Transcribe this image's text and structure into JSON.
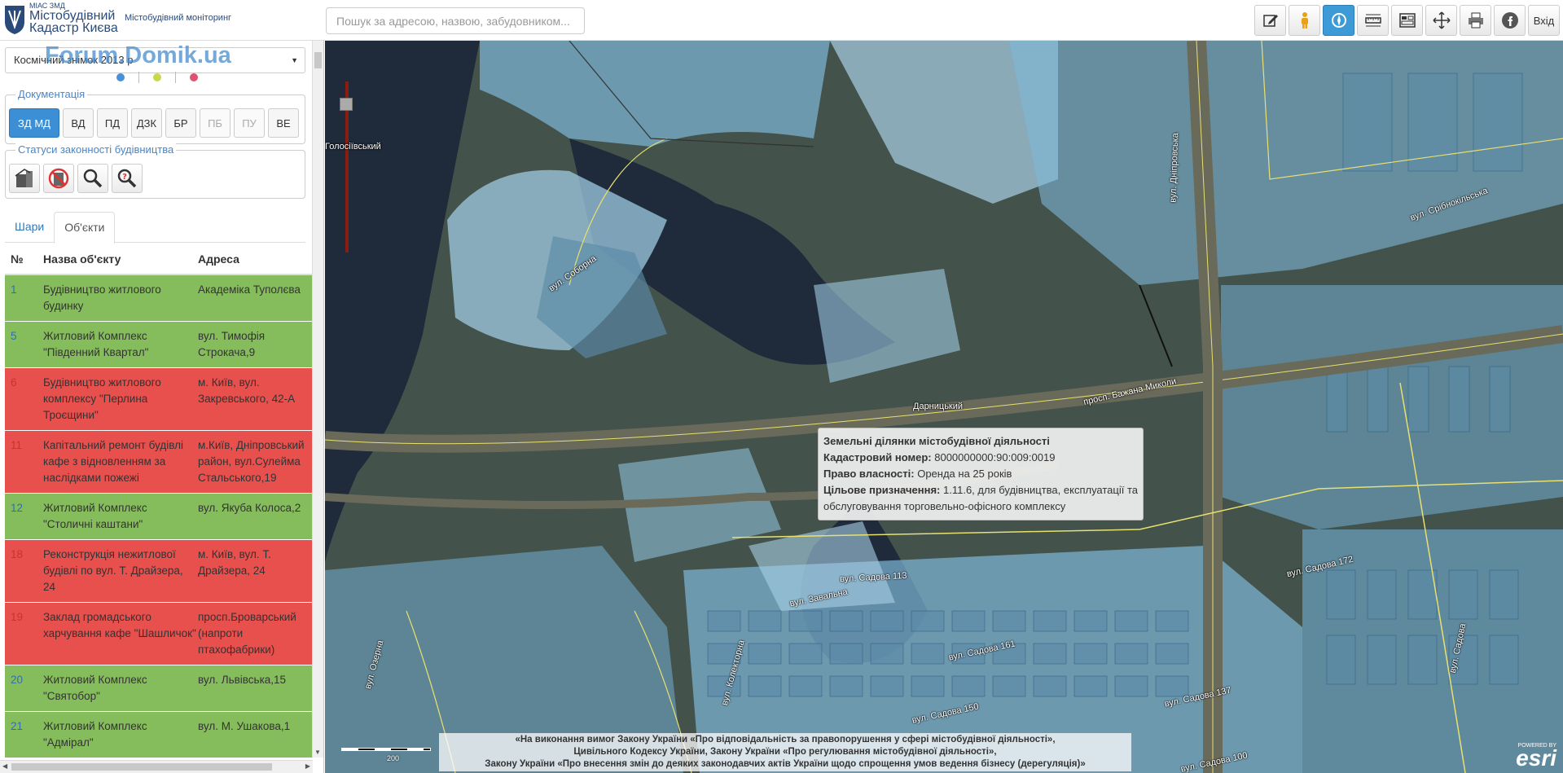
{
  "header": {
    "logo_small": "МІАС ЗМД",
    "logo_line1": "Містобудівний",
    "logo_line2": "Кадастр Києва",
    "monitor_label": "Містобудівний моніторинг",
    "search_placeholder": "Пошук за адресою, назвою, забудовником...",
    "toolbar": [
      {
        "icon": "edit-icon"
      },
      {
        "icon": "street-view-person-icon"
      },
      {
        "icon": "compass-icon",
        "active": true
      },
      {
        "icon": "measure-ruler-icon"
      },
      {
        "icon": "layers-compare-icon"
      },
      {
        "icon": "crosshair-move-icon"
      },
      {
        "icon": "print-icon"
      },
      {
        "icon": "facebook-icon"
      }
    ],
    "login_label": "Вхід"
  },
  "sidebar": {
    "basemap_value": "Космічний знімок 2013 р",
    "watermark": "Forum.Domik.ua",
    "dot_colors": [
      "#4a90d9",
      "#c8d84a",
      "#e05070"
    ],
    "documentation": {
      "legend": "Документація",
      "buttons": [
        "ЗД МД",
        "ВД",
        "ПД",
        "ДЗК",
        "БР",
        "ПБ",
        "ПУ",
        "ВЕ"
      ]
    },
    "statuses": {
      "legend": "Статуси законності будівництва",
      "buttons": [
        "legal-building-icon",
        "illegal-building-icon",
        "inspection-magnifier-icon",
        "unknown-status-icon"
      ]
    },
    "tabs": [
      "Шари",
      "Об'єкти"
    ],
    "table": {
      "headers": {
        "num": "№",
        "name": "Назва об'єкту",
        "address": "Адреса"
      },
      "rows": [
        {
          "num": "1",
          "name": "Будівництво житлового будинку",
          "address": "Академіка Туполєва",
          "status": "green"
        },
        {
          "num": "5",
          "name": "Житловий Комплекс \"Південний Квартал\"",
          "address": "вул. Тимофія Строкача,9",
          "status": "green"
        },
        {
          "num": "6",
          "name": "Будівництво житлового комплексу \"Перлина Троєщини\"",
          "address": "м. Київ, вул. Закревського, 42-А",
          "status": "red"
        },
        {
          "num": "11",
          "name": "Капітальний ремонт будівлі кафе з відновленням за наслідками пожежі",
          "address": "м.Київ, Дніпровський район, вул.Сулейма Стальського,19",
          "status": "red"
        },
        {
          "num": "12",
          "name": "Житловий Комплекс \"Столичні каштани\"",
          "address": "вул. Якуба Колоса,2",
          "status": "green"
        },
        {
          "num": "18",
          "name": "Реконструкція нежитлової будівлі по вул. Т. Драйзера, 24",
          "address": "м. Київ, вул. Т. Драйзера, 24",
          "status": "red"
        },
        {
          "num": "19",
          "name": "Заклад громадського харчування кафе \"Шашличок\"",
          "address": "просп.Броварський (напроти птахофабрики)",
          "status": "red"
        },
        {
          "num": "20",
          "name": "Житловий Комплекс \"Святобор\"",
          "address": "вул. Львівська,15",
          "status": "green"
        },
        {
          "num": "21",
          "name": "Житловий Комплекс \"Адмірал\"",
          "address": "вул. М. Ушакова,1",
          "status": "green"
        }
      ]
    }
  },
  "map": {
    "labels": {
      "holosiivskyi": "Голосіївський",
      "darnytskyi": "Дарницький"
    },
    "streets": [
      "вул. Дніпровська",
      "вул. Срібнокільська",
      "просп. Бажана Миколи",
      "вул. Садова 113",
      "вул. Садова 172",
      "вул. Садова 161",
      "вул. Садова 137",
      "вул. Садова 150",
      "вул. Садова 100",
      "вул. Завальна",
      "вул. Колекторна",
      "вул. Соборна",
      "вул. Озерна",
      "вул. Садова"
    ],
    "popup": {
      "title": "Земельні ділянки містобудівної діяльності",
      "cadastral_label": "Кадастровий номер:",
      "cadastral_value": "8000000000:90:009:0019",
      "ownership_label": "Право власності:",
      "ownership_value": "Оренда на 25 років",
      "purpose_label": "Цільове призначення:",
      "purpose_value": "1.11.6, для будівництва, експлуатації та обслуговування торговельно-офісного комплексу"
    },
    "footer_lines": [
      "«На виконання вимог Закону України «Про відповідальність за правопорушення у сфері містобудівної діяльності»,",
      "Цивільного Кодексу України, Закону України «Про регулювання містобудівної діяльності»,",
      "Закону України «Про внесення змін до деяких законодавчих актів України щодо спрощення умов ведення бізнесу (дерегуляція)»"
    ],
    "scale_label": "200",
    "esri_small": "POWERED BY",
    "esri_big": "esri"
  }
}
